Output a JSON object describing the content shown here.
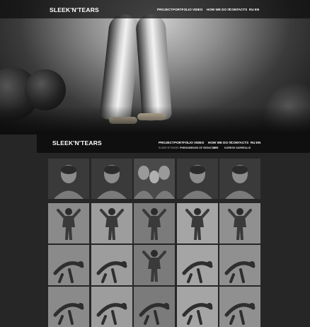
{
  "header": {
    "brand": "SLEEK'N'TEARS",
    "nav": [
      "PROJECT",
      "PORTFOLIO",
      "VIDEO",
      "HOW WE DO IT",
      "CONTACTS",
      "RU EN"
    ]
  },
  "page_header": {
    "brand": "SLEEK'N'TEARS",
    "nav": [
      "PROJECT",
      "PORTFOLIO",
      "VIDEO",
      "HOW WE DO IT",
      "CONTACTS",
      "RU EN"
    ],
    "submenu": [
      "SLEEK'N'TEARS",
      "PHENOMENON OF SEDUCTION",
      "ART",
      "KORESH SURREALIS"
    ]
  },
  "gallery": {
    "rows": [
      [
        "portrait",
        "portrait",
        "group",
        "portrait",
        "portrait"
      ],
      [
        "pose",
        "pose",
        "pose",
        "pose",
        "pose"
      ],
      [
        "acro",
        "acro",
        "pose",
        "acro",
        "acro"
      ],
      [
        "acro",
        "acro",
        "acro",
        "acro",
        "acro"
      ]
    ]
  }
}
